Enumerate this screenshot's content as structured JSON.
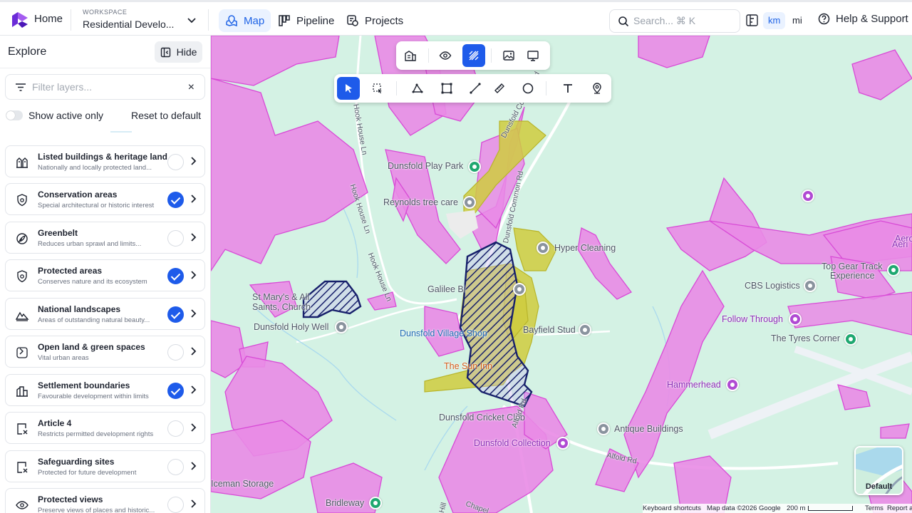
{
  "topbar": {
    "home_label": "Home",
    "workspace_caption": "WORKSPACE",
    "workspace_name": "Residential Develo...",
    "nav": [
      {
        "label": "Map",
        "icon": "map-icon",
        "active": true
      },
      {
        "label": "Pipeline",
        "icon": "pipeline-icon",
        "active": false
      },
      {
        "label": "Projects",
        "icon": "projects-icon",
        "active": false
      }
    ],
    "search_placeholder": "Search... ⌘ K",
    "units": {
      "km": "km",
      "mi": "mi",
      "selected": "km"
    },
    "help_label": "Help & Support"
  },
  "sidebar": {
    "title": "Explore",
    "hide_label": "Hide",
    "filter_placeholder": "Filter layers...",
    "show_active_label": "Show active only",
    "show_active_on": false,
    "reset_label": "Reset to default",
    "layers": [
      {
        "name": "Listed buildings & heritage land",
        "desc": "Nationally and locally protected land...",
        "checked": false,
        "icon": "heritage-icon"
      },
      {
        "name": "Conservation areas",
        "desc": "Special architectural or historic interest",
        "checked": true,
        "icon": "shield-icon"
      },
      {
        "name": "Greenbelt",
        "desc": "Reduces urban sprawl and limits...",
        "checked": false,
        "icon": "leaf-icon"
      },
      {
        "name": "Protected areas",
        "desc": "Conserves nature and its ecosystem",
        "checked": true,
        "icon": "shield-icon"
      },
      {
        "name": "National landscapes",
        "desc": "Areas of outstanding natural beauty...",
        "checked": true,
        "icon": "mountain-icon"
      },
      {
        "name": "Open land & green spaces",
        "desc": "Vital urban areas",
        "checked": false,
        "icon": "tree-icon"
      },
      {
        "name": "Settlement boundaries",
        "desc": "Favourable development within limits",
        "checked": true,
        "icon": "buildings-icon"
      },
      {
        "name": "Article 4",
        "desc": "Restricts permitted development rights",
        "checked": false,
        "icon": "document-x-icon"
      },
      {
        "name": "Safeguarding sites",
        "desc": "Protected for future development",
        "checked": false,
        "icon": "document-x-icon"
      },
      {
        "name": "Protected views",
        "desc": "Preserve views of places and historic...",
        "checked": false,
        "icon": "view-pin-icon"
      }
    ]
  },
  "map": {
    "places": [
      "Dunsfold Play Park",
      "Reynolds tree care",
      "Hyper Cleaning",
      "Galilee Bi",
      "St Mary's & All",
      "Saints, Church",
      "Dunsfold Holy Well",
      "Dunsfold Village Shop",
      "Bayfield Stud",
      "The Sun Inn",
      "Dunsfold Cricket Club",
      "Antique Buildings",
      "Dunsfold Collection",
      "Top Gear Track",
      "Experience",
      "CBS Logistics",
      "Follow Through",
      "The Tyres Corner",
      "Hammerhead",
      "Aero",
      "Aeri",
      "Bridleway",
      "Iceman Storage"
    ],
    "roads": [
      "Dunsfold Common Rd",
      "Dunsfold Common Rd",
      "Hook House Ln",
      "Hook House Ln",
      "Hook House Ln",
      "Alfold Rd",
      "Alfold Rd",
      "Chapel",
      "Hill",
      "Alfold Rd"
    ],
    "attribution": {
      "shortcuts": "Keyboard shortcuts",
      "map_data": "Map data ©2026 Google",
      "scale": "200 m",
      "terms": "Terms",
      "report": "Report a"
    },
    "basemap_label": "Default",
    "colors": {
      "land": "#d4f2e4",
      "protected_magenta": "#e98be6",
      "protected_stroke": "#d84ad6",
      "settlement_yellow": "#cfcc3e",
      "conservation_navy": "#17206b",
      "accent": "#1e5bea"
    }
  },
  "view_toolbar": [
    "layers-icon",
    "eye-icon",
    "draw-mode-icon",
    "image-icon",
    "monitor-icon"
  ],
  "draw_toolbar": [
    "pointer-icon",
    "select-area-icon",
    "polyline-icon",
    "rectangle-icon",
    "line-icon",
    "ruler-icon",
    "circle-icon",
    "text-icon",
    "pin-icon"
  ]
}
